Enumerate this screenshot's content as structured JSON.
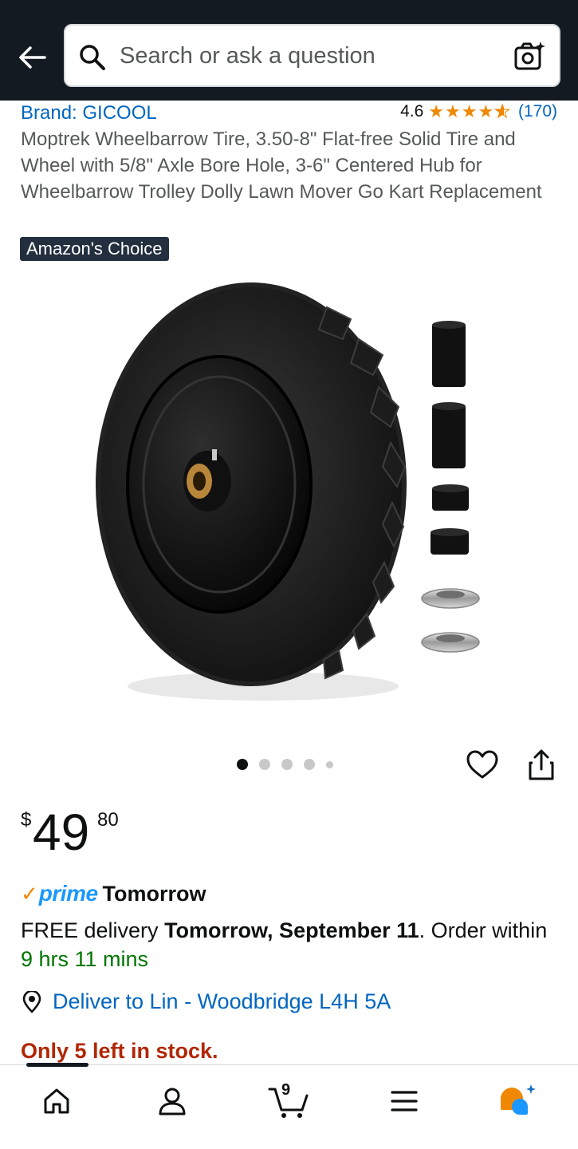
{
  "search": {
    "placeholder": "Search or ask a question"
  },
  "product": {
    "brand_label": "Brand: GICOOL",
    "rating_value": "4.6",
    "rating_stars": 4.6,
    "review_count": "(170)",
    "title": "Moptrek Wheelbarrow Tire, 3.50-8\" Flat-free Solid Tire and Wheel with 5/8\" Axle Bore Hole, 3-6\" Centered Hub for Wheelbarrow Trolley Dolly Lawn Mover Go Kart Replacement",
    "badge": "Amazon's Choice",
    "image_count": 5,
    "image_active_index": 0
  },
  "price": {
    "symbol": "$",
    "whole": "49",
    "fraction": "80"
  },
  "delivery": {
    "prime_check": "✓",
    "prime_label": "prime",
    "prime_when": "Tomorrow",
    "line_prefix": "FREE delivery ",
    "line_date": "Tomorrow, September 11",
    "line_mid": ". Order within ",
    "countdown": "9 hrs 11 mins",
    "location": "Deliver to Lin - Woodbridge L4H 5A",
    "stock": "Only 5 left in stock."
  },
  "nav": {
    "cart_count": "9",
    "items": [
      "home-icon",
      "account-icon",
      "cart-icon",
      "menu-icon",
      "rufus-icon"
    ]
  },
  "colors": {
    "header_bg": "#131a22",
    "link": "#0066c0",
    "star": "#f08804",
    "prime_blue": "#1a98ff",
    "countdown_green": "#007600",
    "stock_red": "#b12704",
    "badge_bg": "#232f3e"
  }
}
